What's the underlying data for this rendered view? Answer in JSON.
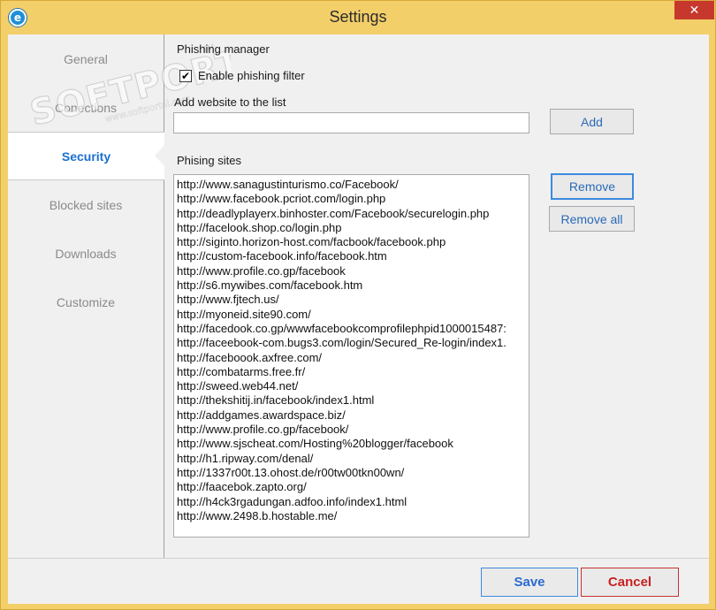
{
  "window": {
    "title": "Settings",
    "app_icon": "e",
    "close_icon": "✕"
  },
  "watermark": {
    "text": "SOFTPORTAL",
    "tm": "TM",
    "url": "www.softportal.com"
  },
  "sidebar": {
    "items": [
      {
        "label": "General",
        "active": false
      },
      {
        "label": "Conections",
        "active": false
      },
      {
        "label": "Security",
        "active": true
      },
      {
        "label": "Blocked sites",
        "active": false
      },
      {
        "label": "Downloads",
        "active": false
      },
      {
        "label": "Customize",
        "active": false
      }
    ]
  },
  "security": {
    "section_title": "Phishing manager",
    "enable_filter_label": "Enable phishing filter",
    "enable_filter_checked": true,
    "add_website_label": "Add website to the list",
    "add_website_value": "",
    "add_button": "Add",
    "sites_label": "Phising sites",
    "remove_button": "Remove",
    "remove_all_button": "Remove all",
    "sites": [
      "http://www.sanagustinturismo.co/Facebook/",
      "http://www.facebook.pcriot.com/login.php",
      "http://deadlyplayerx.binhoster.com/Facebook/securelogin.php",
      "http://facelook.shop.co/login.php",
      "http://siginto.horizon-host.com/facbook/facebook.php",
      "http://custom-facebook.info/facebook.htm",
      "http://www.profile.co.gp/facebook",
      "http://s6.mywibes.com/facebook.htm",
      "http://www.fjtech.us/",
      "http://myoneid.site90.com/",
      "http://facedook.co.gp/wwwfacebookcomprofilephpid1000015487:",
      "http://faceebook-com.bugs3.com/login/Secured_Re-login/index1.",
      "http://faceboook.axfree.com/",
      "http://combatarms.free.fr/",
      "http://sweed.web44.net/",
      "http://thekshitij.in/facebook/index1.html",
      "http://addgames.awardspace.biz/",
      "http://www.profile.co.gp/facebook/",
      "http://www.sjscheat.com/Hosting%20blogger/facebook",
      "http://h1.ripway.com/denal/",
      "http://1337r00t.13.ohost.de/r00tw00tkn00wn/",
      "http://faacebok.zapto.org/",
      "http://h4ck3rgadungan.adfoo.info/index1.html",
      "http://www.2498.b.hostable.me/"
    ]
  },
  "footer": {
    "save_button": "Save",
    "cancel_button": "Cancel"
  },
  "colors": {
    "frame": "#f3cf6a",
    "accent_blue": "#3c8ae0",
    "cancel_red": "#c83232",
    "active_label": "#1a6fd0"
  }
}
